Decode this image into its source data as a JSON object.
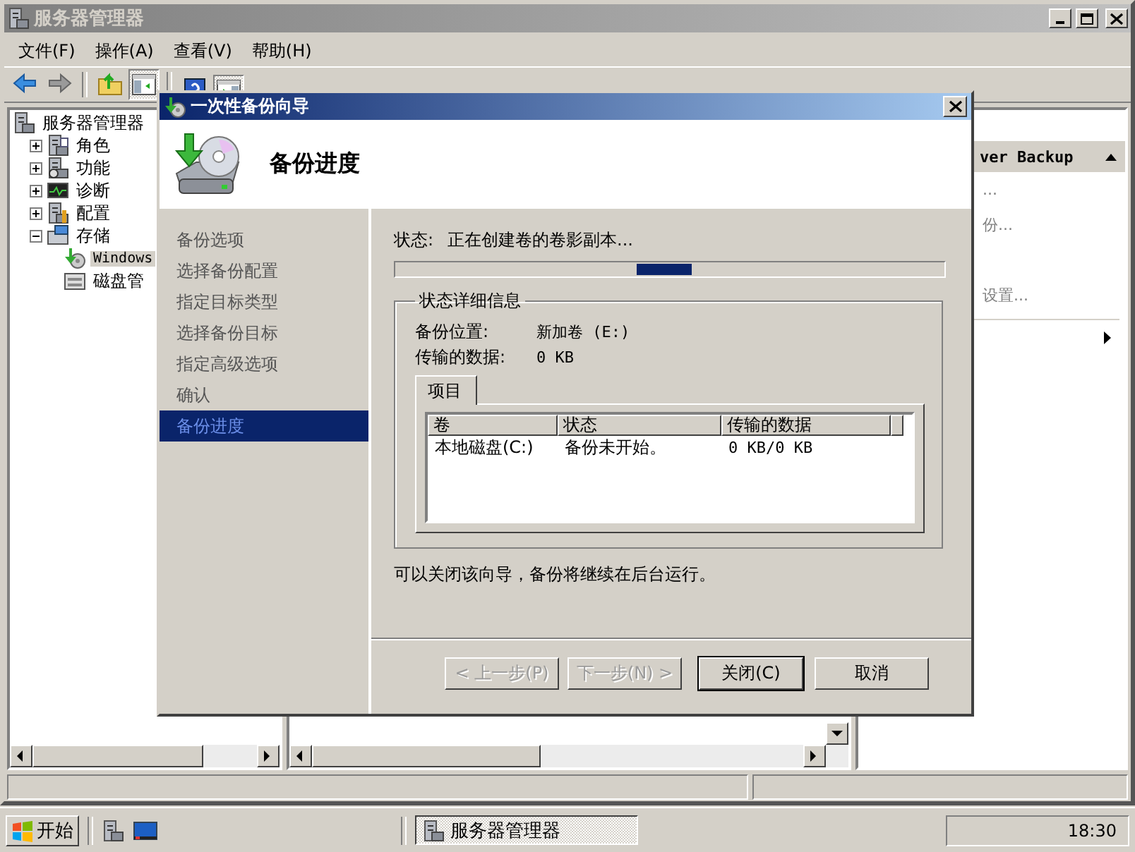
{
  "window": {
    "title": "服务器管理器",
    "active": false
  },
  "menu": [
    {
      "label": "文件(F)"
    },
    {
      "label": "操作(A)"
    },
    {
      "label": "查看(V)"
    },
    {
      "label": "帮助(H)"
    }
  ],
  "toolbar": [
    {
      "kind": "back",
      "pressed": false
    },
    {
      "kind": "forward",
      "pressed": false
    },
    {
      "kind": "separator"
    },
    {
      "kind": "up",
      "pressed": false
    },
    {
      "kind": "tree",
      "pressed": true
    },
    {
      "kind": "separator"
    },
    {
      "kind": "help",
      "pressed": false
    },
    {
      "kind": "actions",
      "pressed": true
    }
  ],
  "tree": [
    {
      "label": "服务器管理器",
      "kind": "server",
      "selected": false,
      "expanded": true,
      "children": [
        {
          "label": "角色",
          "kind": "roles",
          "selected": false,
          "expanded": false
        },
        {
          "label": "功能",
          "kind": "features",
          "selected": false,
          "expanded": false
        },
        {
          "label": "诊断",
          "kind": "diagnostics",
          "selected": false,
          "expanded": false
        },
        {
          "label": "配置",
          "kind": "config",
          "selected": false,
          "expanded": false
        },
        {
          "label": "存储",
          "kind": "storage",
          "selected": false,
          "expanded": true,
          "children": [
            {
              "label": "Windows",
              "kind": "backup",
              "selected": true
            },
            {
              "label": "磁盘管",
              "kind": "disk",
              "selected": false
            }
          ]
        }
      ]
    }
  ],
  "actions_pane": {
    "header": "ver Backup",
    "items": [
      {
        "label": "...",
        "kind": "text"
      },
      {
        "label": "份...",
        "kind": "text"
      },
      {
        "label": "设置...",
        "kind": "text"
      },
      {
        "kind": "submenu"
      }
    ]
  },
  "dialog": {
    "title": "一次性备份向导",
    "heading": "备份进度",
    "steps": [
      {
        "label": "备份选项",
        "selected": false
      },
      {
        "label": "选择备份配置",
        "selected": false
      },
      {
        "label": "指定目标类型",
        "selected": false
      },
      {
        "label": "选择备份目标",
        "selected": false
      },
      {
        "label": "指定高级选项",
        "selected": false
      },
      {
        "label": "确认",
        "selected": false
      },
      {
        "label": "备份进度",
        "selected": true
      }
    ],
    "status_label": "状态:",
    "status_text": "正在创建卷的卷影副本...",
    "details": {
      "title": "状态详细信息",
      "fields": [
        {
          "label": "备份位置:",
          "value": "新加卷 (E:)"
        },
        {
          "label": "传输的数据:",
          "value": "0 KB"
        }
      ],
      "tabs": [
        {
          "label": "项目",
          "selected": true
        }
      ],
      "columns": [
        "卷",
        "状态",
        "传输的数据"
      ],
      "rows": [
        [
          "本地磁盘(C:)",
          "备份未开始。",
          "0 KB/0 KB"
        ]
      ]
    },
    "note": "可以关闭该向导，备份将继续在后台运行。",
    "buttons": [
      {
        "label": "< 上一步(P)",
        "disabled": true,
        "default": false
      },
      {
        "label": "下一步(N) >",
        "disabled": true,
        "default": false
      },
      {
        "label": "关闭(C)",
        "disabled": false,
        "default": true
      },
      {
        "label": "取消",
        "disabled": false,
        "default": false
      }
    ]
  },
  "taskbar": {
    "start": "开始",
    "tasks": [
      {
        "label": "服务器管理器",
        "selected": true
      }
    ],
    "clock": "18:30"
  }
}
